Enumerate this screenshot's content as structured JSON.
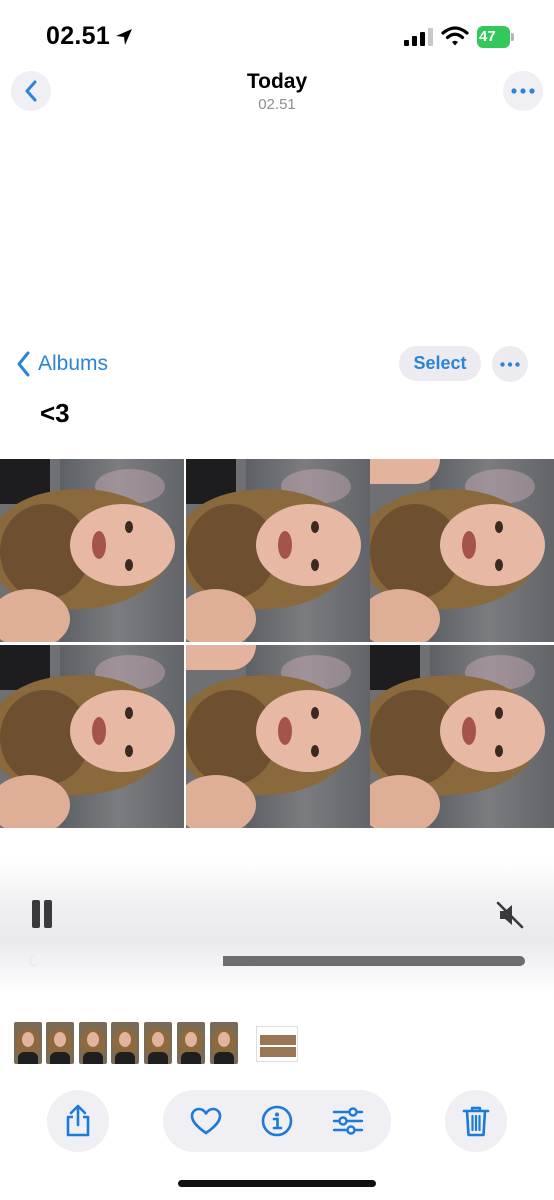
{
  "status_bar": {
    "time": "02.51",
    "battery": "47",
    "icons": [
      "location-arrow-icon",
      "cellular-signal-icon",
      "wifi-icon",
      "battery-charging-icon"
    ]
  },
  "nav": {
    "title": "Today",
    "subtitle": "02.51",
    "back_icon": "chevron-left-icon",
    "more_icon": "ellipsis-icon"
  },
  "album": {
    "back_label": "Albums",
    "select_label": "Select",
    "title": "<3",
    "photo_count": 6
  },
  "player": {
    "state": "playing",
    "pause_icon": "pause-icon",
    "mute_icon": "speaker-muted-icon",
    "progress": 0.39
  },
  "filmstrip": {
    "thumbnail_count": 8
  },
  "toolbar": {
    "icons": [
      "share-icon",
      "heart-icon",
      "info-icon",
      "adjust-sliders-icon",
      "trash-icon"
    ],
    "accent": "#1c7ad8"
  },
  "colors": {
    "accent": "#2b84d6",
    "battery": "#34c759"
  }
}
